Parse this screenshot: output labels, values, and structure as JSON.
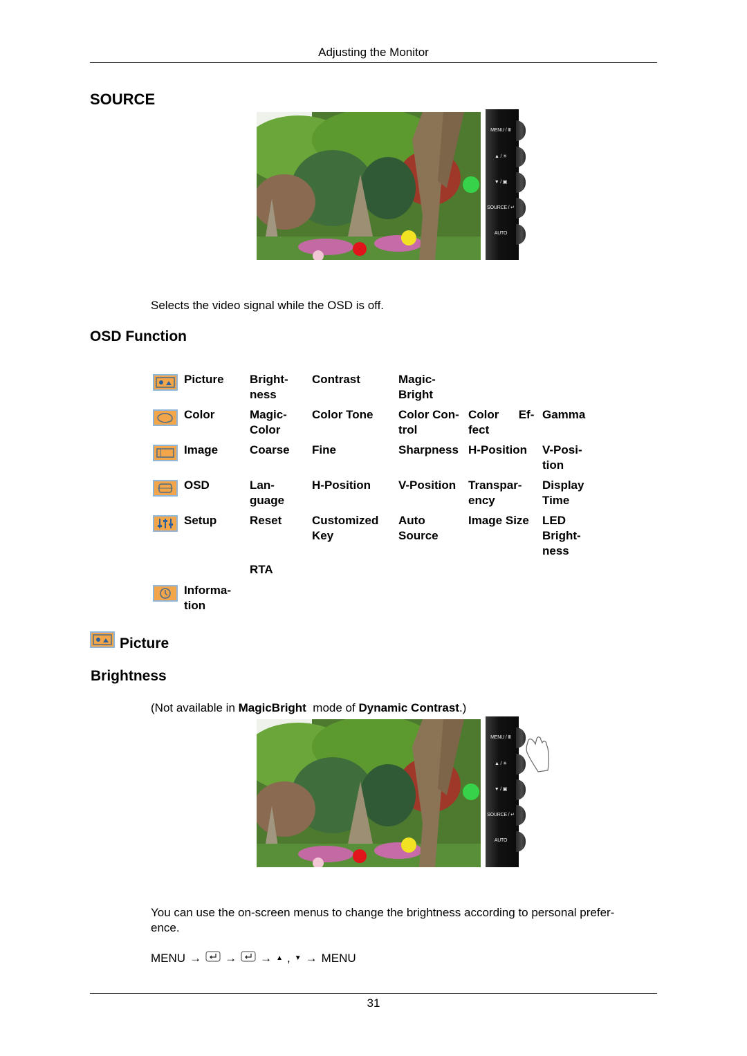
{
  "header": {
    "title": "Adjusting the Monitor"
  },
  "source_section": {
    "heading": "SOURCE",
    "description": "Selects the video signal while the OSD is off."
  },
  "control_panel": {
    "buttons": [
      {
        "label": "MENU / Ⅲ",
        "icon": "menu-icon"
      },
      {
        "label": "▲ / ☀",
        "icon": "brightness-icon"
      },
      {
        "label": "▼ / ▣",
        "icon": "down-icon"
      },
      {
        "label": "SOURCE / ↵",
        "icon": "enter-icon"
      },
      {
        "label": "AUTO",
        "icon": "auto-icon"
      }
    ]
  },
  "osd_section": {
    "heading": "OSD Function",
    "rows": [
      {
        "icon": "picture-icon",
        "menu": "Picture",
        "items": [
          "Bright-\nness",
          "Contrast",
          "Magic-\nBright",
          "",
          ""
        ]
      },
      {
        "icon": "color-icon",
        "menu": "Color",
        "items": [
          "Magic-\nColor",
          "Color Tone",
          "Color Con-\ntrol",
          "Color      Ef-\nfect",
          "Gamma"
        ]
      },
      {
        "icon": "image-icon",
        "menu": "Image",
        "items": [
          "Coarse",
          "Fine",
          "Sharpness",
          "H-Position",
          "V-Posi-\ntion"
        ]
      },
      {
        "icon": "osd-icon",
        "menu": "OSD",
        "items": [
          "Lan-\nguage",
          "H-Position",
          "V-Position",
          "Transpar-\nency",
          "Display\nTime"
        ]
      },
      {
        "icon": "setup-icon",
        "menu": "Setup",
        "items": [
          "Reset",
          "Customized\nKey",
          "Auto\nSource",
          "Image Size",
          "LED\nBright-\nness"
        ]
      },
      {
        "icon": "",
        "menu": "",
        "items": [
          "RTA",
          "",
          "",
          "",
          ""
        ]
      },
      {
        "icon": "information-icon",
        "menu": "Informa-\ntion",
        "items": [
          "",
          "",
          "",
          "",
          ""
        ]
      }
    ]
  },
  "picture_section": {
    "heading": "Picture"
  },
  "brightness_section": {
    "heading": "Brightness",
    "note_prefix": "(Not available in ",
    "note_bold1": "MagicBright",
    "note_mid": "  mode of ",
    "note_bold2": "Dynamic Contrast",
    "note_suffix": ".)",
    "description": "You can use the on-screen menus to change the brightness according to personal prefer-\nence.",
    "sequence": [
      "MENU",
      "→",
      "enter",
      "→",
      "enter",
      "→",
      "▲",
      ",",
      "▼",
      "→",
      "MENU"
    ]
  },
  "footer": {
    "page_number": "31"
  },
  "colors": {
    "icon_fill": "#f3a649",
    "icon_border": "#8fb5d8",
    "rule": "#333333"
  }
}
